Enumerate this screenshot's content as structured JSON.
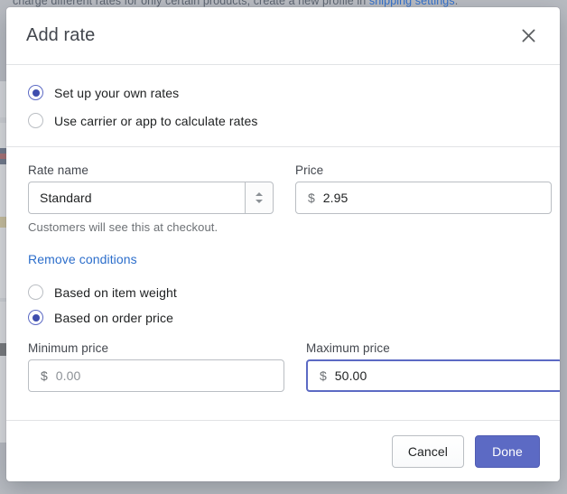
{
  "backdrop": {
    "text_before_link": "charge different rates for only certain products, create a new profile in ",
    "link_text": "shipping settings",
    "text_after_link": "."
  },
  "dialog": {
    "title": "Add rate",
    "close_icon": "close-icon",
    "method_options": [
      {
        "label": "Set up your own rates",
        "selected": true
      },
      {
        "label": "Use carrier or app to calculate rates",
        "selected": false
      }
    ],
    "rate_name": {
      "label": "Rate name",
      "value": "Standard",
      "placeholder": "Rate name",
      "helper": "Customers will see this at checkout.",
      "stepper_icon": "up-down-stepper-icon"
    },
    "price": {
      "label": "Price",
      "currency_symbol": "$",
      "value": "2.95",
      "placeholder": "0.00"
    },
    "remove_conditions_label": "Remove conditions",
    "condition_options": [
      {
        "label": "Based on item weight",
        "selected": false
      },
      {
        "label": "Based on order price",
        "selected": true
      }
    ],
    "minimum_price": {
      "label": "Minimum price",
      "currency_symbol": "$",
      "value": "",
      "placeholder": "0.00",
      "focused": false
    },
    "maximum_price": {
      "label": "Maximum price",
      "currency_symbol": "$",
      "value": "50.00",
      "placeholder": "0.00",
      "focused": true
    },
    "footer": {
      "cancel_label": "Cancel",
      "done_label": "Done"
    }
  },
  "colors": {
    "accent": "#5c6ac4",
    "radio_dot": "#3f4eae",
    "link": "#2c6ecb",
    "border": "#babec3",
    "divider": "#e1e3e5",
    "text": "#202223",
    "muted_text": "#6d7175",
    "backdrop": "#b9bcc2"
  }
}
